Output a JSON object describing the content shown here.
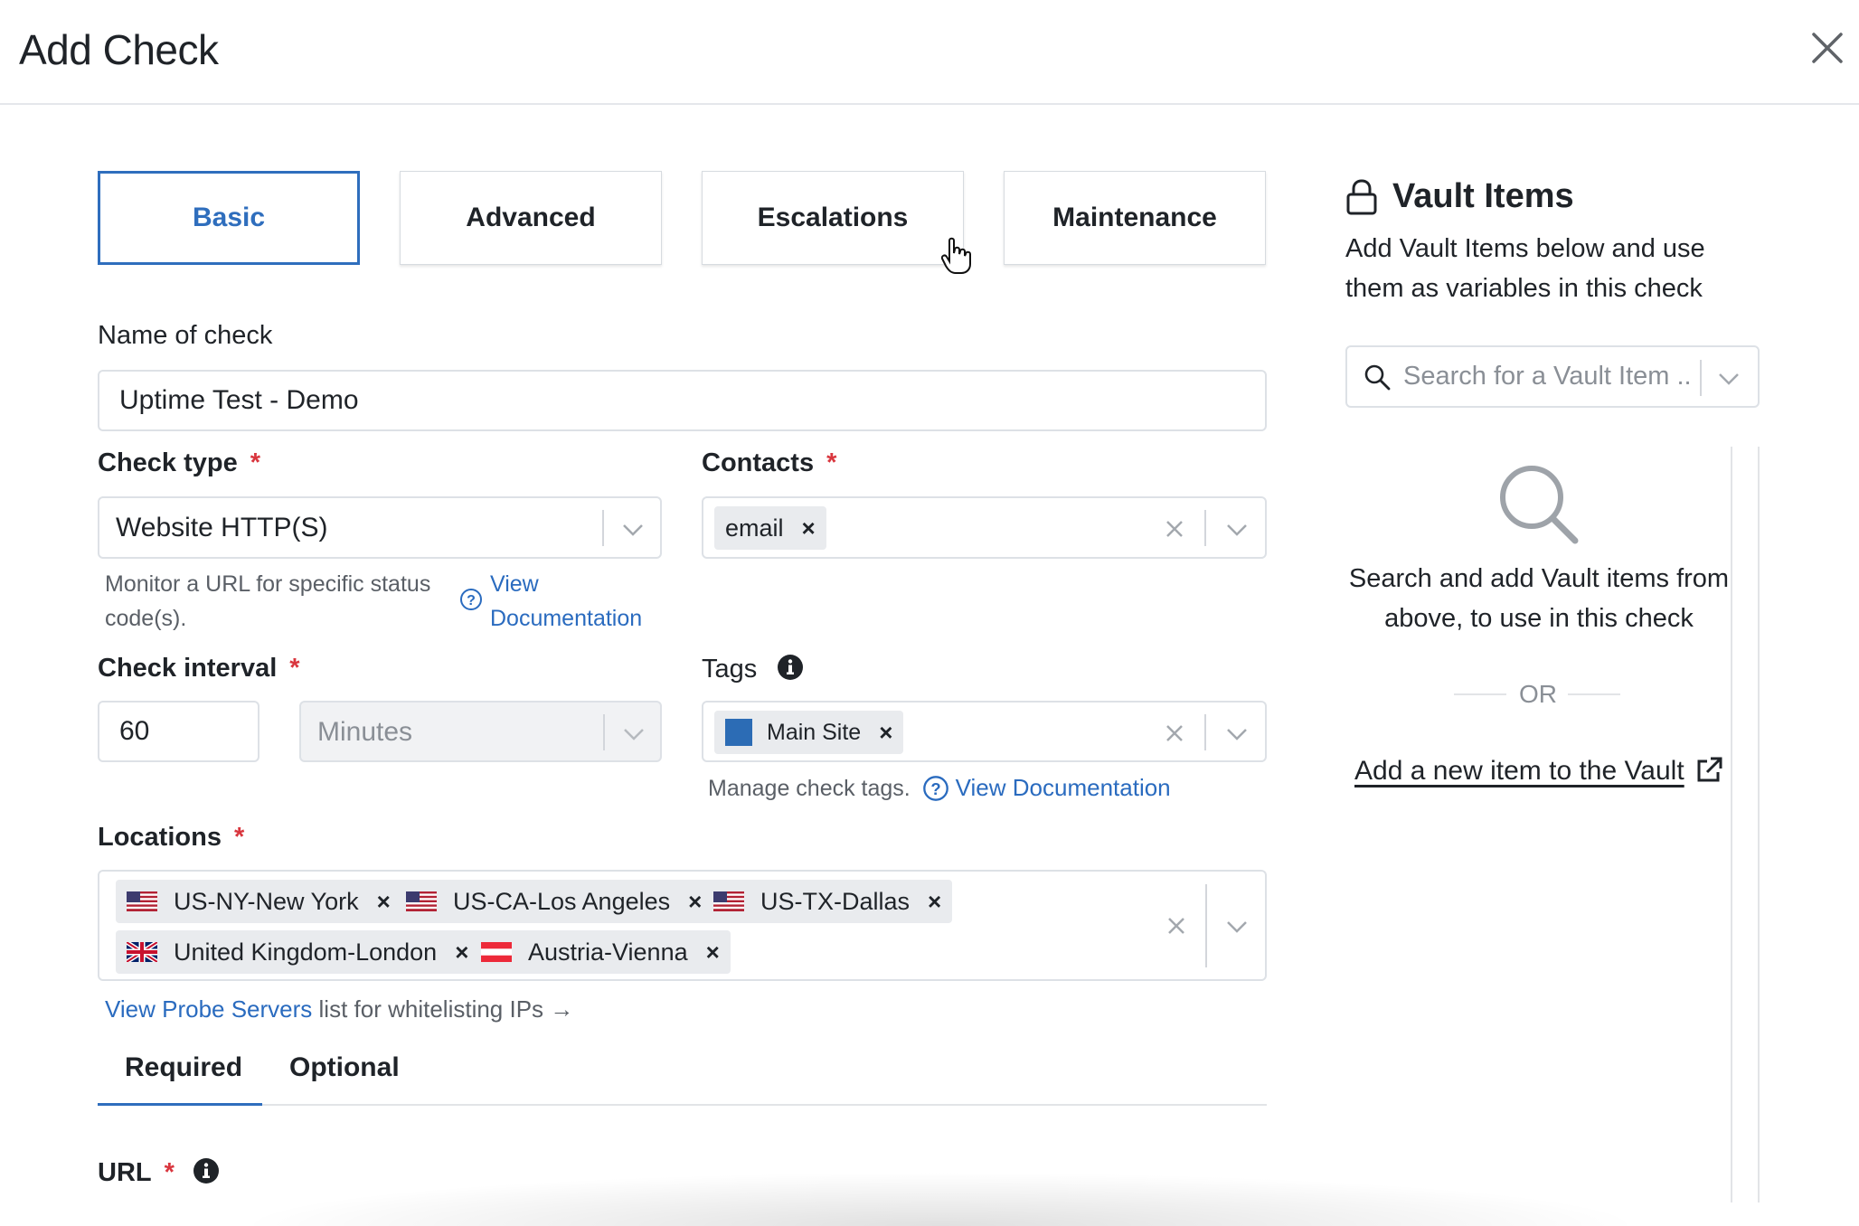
{
  "dialog": {
    "title": "Add Check"
  },
  "tabs": [
    {
      "label": "Basic",
      "active": true
    },
    {
      "label": "Advanced",
      "active": false
    },
    {
      "label": "Escalations",
      "active": false
    },
    {
      "label": "Maintenance",
      "active": false
    }
  ],
  "name_field": {
    "label": "Name of check",
    "value": "Uptime Test - Demo"
  },
  "check_type": {
    "label": "Check type",
    "required_mark": "*",
    "value": "Website HTTP(S)",
    "help_text": "Monitor a URL for specific status code(s).",
    "help_link": "View Documentation"
  },
  "contacts": {
    "label": "Contacts",
    "required_mark": "*",
    "chips": [
      "email"
    ]
  },
  "check_interval": {
    "label": "Check interval",
    "required_mark": "*",
    "value": "60",
    "unit": "Minutes"
  },
  "tags": {
    "label": "Tags",
    "chips": [
      {
        "label": "Main Site",
        "color": "#2c6cb5"
      }
    ],
    "help_text": "Manage check tags.",
    "help_link": "View Documentation"
  },
  "locations": {
    "label": "Locations",
    "required_mark": "*",
    "chips": [
      {
        "label": "US-NY-New York",
        "flag": "us-flag-icon"
      },
      {
        "label": "US-CA-Los Angeles",
        "flag": "us-flag-icon"
      },
      {
        "label": "US-TX-Dallas",
        "flag": "us-flag-icon"
      },
      {
        "label": "United Kingdom-London",
        "flag": "uk-flag-icon"
      },
      {
        "label": "Austria-Vienna",
        "flag": "austria-flag-icon"
      }
    ],
    "probe_link": "View Probe Servers",
    "probe_text": "list for whitelisting IPs →"
  },
  "subtabs": [
    {
      "label": "Required",
      "active": true
    },
    {
      "label": "Optional",
      "active": false
    }
  ],
  "url_field": {
    "label": "URL",
    "required_mark": "*"
  },
  "vault": {
    "title": "Vault Items",
    "description": "Add Vault Items below and use them as variables in this check",
    "search_placeholder": "Search for a Vault Item ..",
    "empty_text": "Search and add Vault items from above, to use in this check",
    "or_text": "OR",
    "add_link": "Add a new item to the Vault"
  },
  "colors": {
    "accent": "#2f6ebd",
    "link": "#2a6bbf",
    "required": "#d9363e"
  }
}
